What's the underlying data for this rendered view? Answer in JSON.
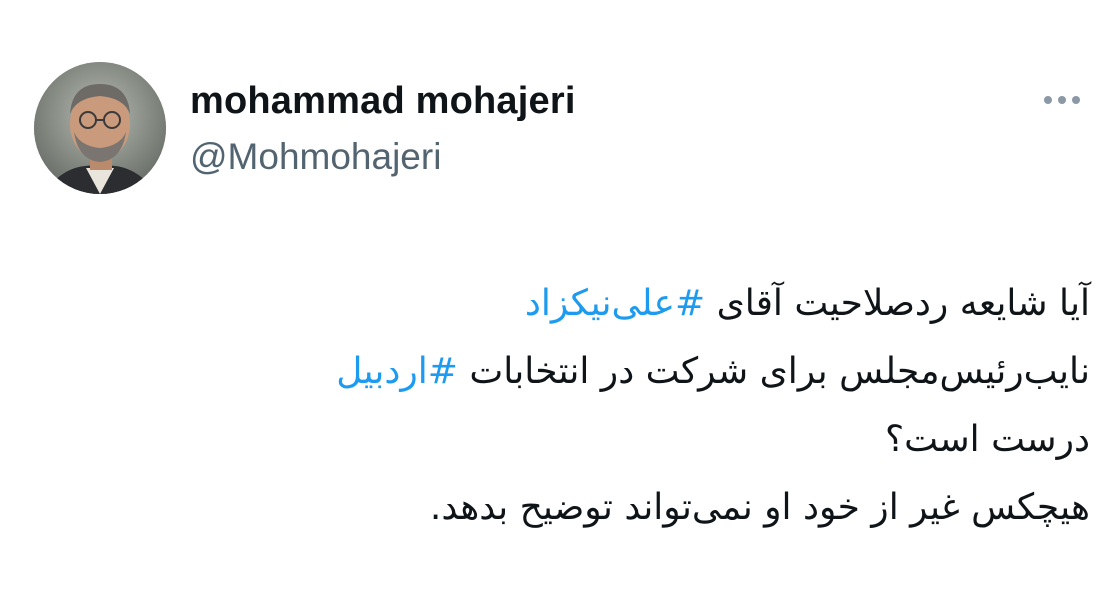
{
  "user": {
    "display_name": "mohammad mohajeri",
    "handle": "@Mohmohajeri",
    "avatar_icon": "profile-photo"
  },
  "menu": {
    "icon": "more-horizontal-icon"
  },
  "tweet": {
    "line1_text": "آیا شایعه ردصلاحیت آقای ",
    "line1_hashtag": "#علی‌نیکزاد",
    "line2_text": "نایب‌رئیس‌مجلس برای شرکت در انتخابات ",
    "line2_hashtag": "#اردبیل",
    "line3_text": "درست است؟",
    "line4_text": "هیچکس غیر از خود او نمی‌تواند توضیح بدهد."
  },
  "colors": {
    "hashtag": "#1d9bf0",
    "text": "#0f1419",
    "secondary": "#536471"
  }
}
